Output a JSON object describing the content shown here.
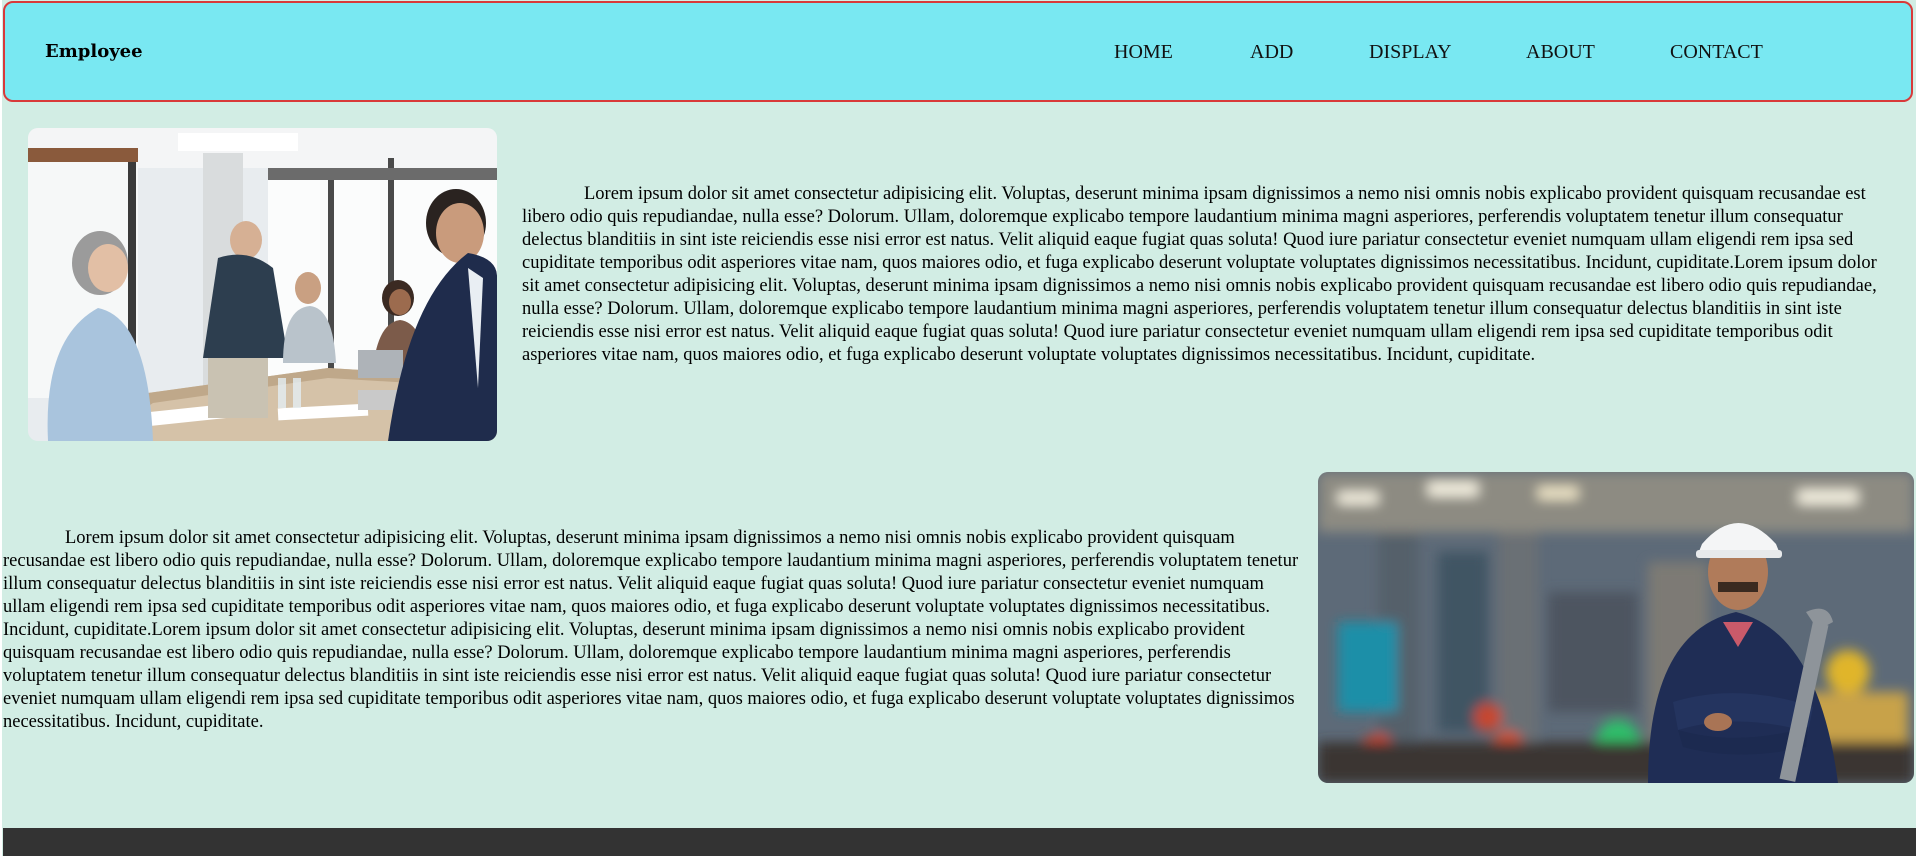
{
  "navbar": {
    "brand": "Employee",
    "links": [
      {
        "label": "HOME"
      },
      {
        "label": "ADD"
      },
      {
        "label": "DISPLAY"
      },
      {
        "label": "ABOUT"
      },
      {
        "label": "CONTACT"
      }
    ]
  },
  "sections": [
    {
      "image_icon": "office-meeting-photo",
      "text": "Lorem ipsum dolor sit amet consectetur adipisicing elit. Voluptas, deserunt minima ipsam dignissimos a nemo nisi omnis nobis explicabo provident quisquam recusandae est libero odio quis repudiandae, nulla esse? Dolorum. Ullam, doloremque explicabo tempore laudantium minima magni asperiores, perferendis voluptatem tenetur illum consequatur delectus blanditiis in sint iste reiciendis esse nisi error est natus. Velit aliquid eaque fugiat quas soluta! Quod iure pariatur consectetur eveniet numquam ullam eligendi rem ipsa sed cupiditate temporibus odit asperiores vitae nam, quos maiores odio, et fuga explicabo deserunt voluptate voluptates dignissimos necessitatibus. Incidunt, cupiditate.Lorem ipsum dolor sit amet consectetur adipisicing elit. Voluptas, deserunt minima ipsam dignissimos a nemo nisi omnis nobis explicabo provident quisquam recusandae est libero odio quis repudiandae, nulla esse? Dolorum. Ullam, doloremque explicabo tempore laudantium minima magni asperiores, perferendis voluptatem tenetur illum consequatur delectus blanditiis in sint iste reiciendis esse nisi error est natus. Velit aliquid eaque fugiat quas soluta! Quod iure pariatur consectetur eveniet numquam ullam eligendi rem ipsa sed cupiditate temporibus odit asperiores vitae nam, quos maiores odio, et fuga explicabo deserunt voluptate voluptates dignissimos necessitatibus. Incidunt, cupiditate."
    },
    {
      "image_icon": "factory-worker-photo",
      "text": "Lorem ipsum dolor sit amet consectetur adipisicing elit. Voluptas, deserunt minima ipsam dignissimos a nemo nisi omnis nobis explicabo provident quisquam recusandae est libero odio quis repudiandae, nulla esse? Dolorum. Ullam, doloremque explicabo tempore laudantium minima magni asperiores, perferendis voluptatem tenetur illum consequatur delectus blanditiis in sint iste reiciendis esse nisi error est natus. Velit aliquid eaque fugiat quas soluta! Quod iure pariatur consectetur eveniet numquam ullam eligendi rem ipsa sed cupiditate temporibus odit asperiores vitae nam, quos maiores odio, et fuga explicabo deserunt voluptate voluptates dignissimos necessitatibus. Incidunt, cupiditate.Lorem ipsum dolor sit amet consectetur adipisicing elit. Voluptas, deserunt minima ipsam dignissimos a nemo nisi omnis nobis explicabo provident quisquam recusandae est libero odio quis repudiandae, nulla esse? Dolorum. Ullam, doloremque explicabo tempore laudantium minima magni asperiores, perferendis voluptatem tenetur illum consequatur delectus blanditiis in sint iste reiciendis esse nisi error est natus. Velit aliquid eaque fugiat quas soluta! Quod iure pariatur consectetur eveniet numquam ullam eligendi rem ipsa sed cupiditate temporibus odit asperiores vitae nam, quos maiores odio, et fuga explicabo deserunt voluptate voluptates dignissimos necessitatibus. Incidunt, cupiditate."
    }
  ],
  "colors": {
    "navbar_bg": "#79e8f2",
    "navbar_border": "#d83a3a",
    "page_bg": "#d2ede4",
    "footer_bg": "#333333"
  }
}
